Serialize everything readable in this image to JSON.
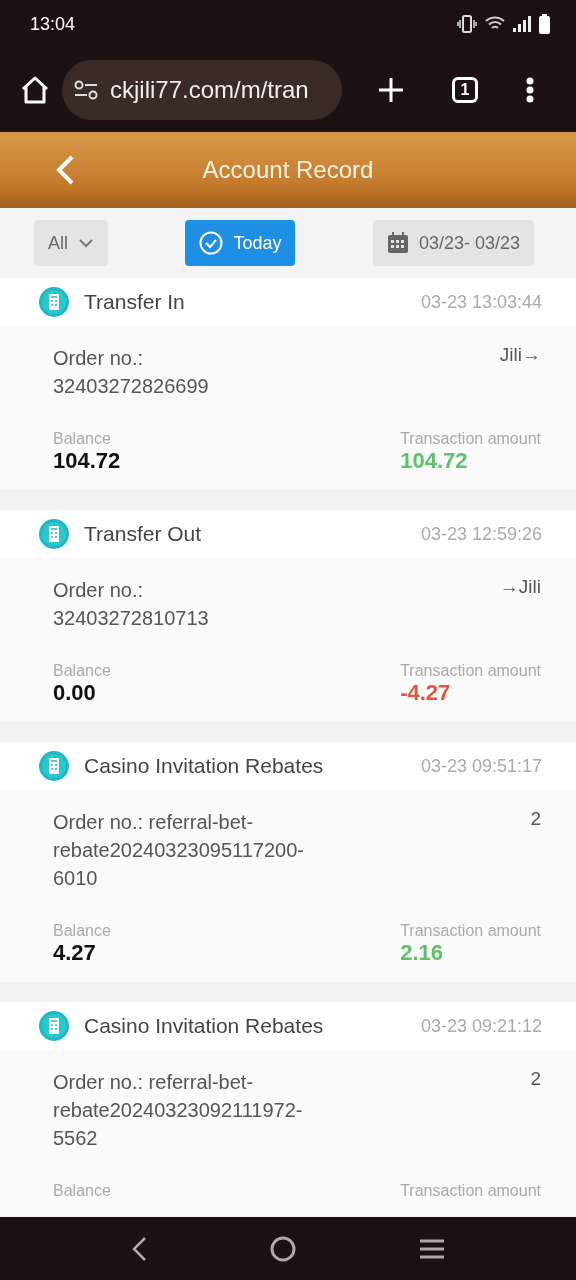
{
  "status_bar": {
    "time": "13:04"
  },
  "browser": {
    "url": "ckjili77.com/m/tran",
    "tab_count": "1"
  },
  "header": {
    "title": "Account Record"
  },
  "filters": {
    "type": "All",
    "today": {
      "label": "Today",
      "selected": true
    },
    "date_range": "03/23- 03/23"
  },
  "records": [
    {
      "title": "Transfer In",
      "time": "03-23 13:03:44",
      "order": "Order no.:\n32403272826699",
      "target": "Jili→",
      "balance_label": "Balance",
      "balance": "104.72",
      "amount_label": "Transaction amount",
      "amount": "104.72",
      "kind": "credit"
    },
    {
      "title": "Transfer Out",
      "time": "03-23 12:59:26",
      "order": "Order no.:\n32403272810713",
      "target": "→Jili",
      "balance_label": "Balance",
      "balance": "0.00",
      "amount_label": "Transaction amount",
      "amount": "-4.27",
      "kind": "debit"
    },
    {
      "title": "Casino Invitation Rebates",
      "time": "03-23 09:51:17",
      "order": "Order no.: referral-bet-rebate20240323095117200-6010",
      "target": "2",
      "balance_label": "Balance",
      "balance": "4.27",
      "amount_label": "Transaction amount",
      "amount": "2.16",
      "kind": "credit"
    },
    {
      "title": "Casino Invitation Rebates",
      "time": "03-23 09:21:12",
      "order": "Order no.: referral-bet-rebate20240323092111972-5562",
      "target": "2",
      "balance_label": "Balance",
      "amount_label": "Transaction amount"
    }
  ]
}
